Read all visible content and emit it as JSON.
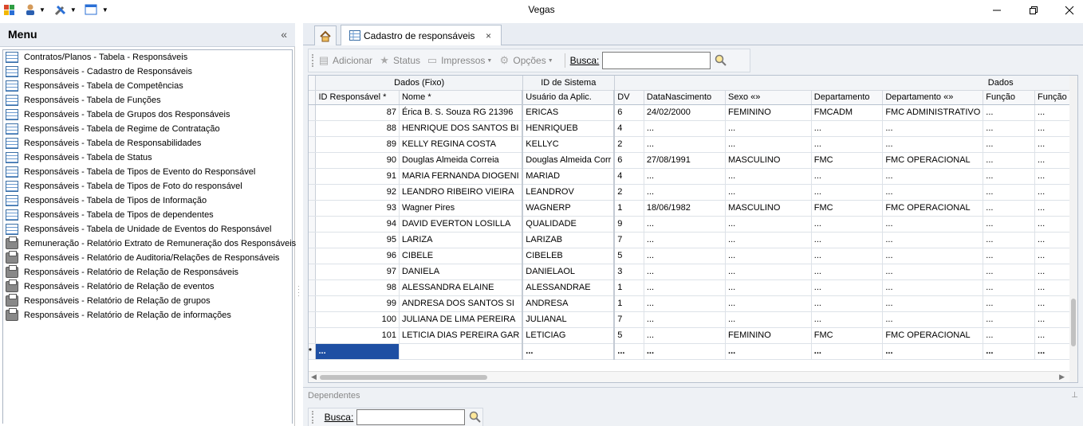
{
  "window": {
    "title": "Vegas",
    "controls": [
      "minimize",
      "restore",
      "close"
    ]
  },
  "menu": {
    "title": "Menu",
    "collapse_label": "«",
    "items": [
      {
        "label": "Contratos/Planos - Tabela - Responsáveis",
        "icon": "table-icon"
      },
      {
        "label": "Responsáveis - Cadastro de Responsáveis",
        "icon": "table-icon"
      },
      {
        "label": "Responsáveis - Tabela de Competências",
        "icon": "table-icon"
      },
      {
        "label": "Responsáveis - Tabela de Funções",
        "icon": "table-icon"
      },
      {
        "label": "Responsáveis - Tabela de Grupos dos Responsáveis",
        "icon": "table-icon"
      },
      {
        "label": "Responsáveis - Tabela de Regime de Contratação",
        "icon": "table-icon"
      },
      {
        "label": "Responsáveis - Tabela de Responsabilidades",
        "icon": "table-icon"
      },
      {
        "label": "Responsáveis - Tabela de Status",
        "icon": "table-icon"
      },
      {
        "label": "Responsáveis - Tabela de Tipos de Evento do Responsável",
        "icon": "table-icon"
      },
      {
        "label": "Responsáveis - Tabela de Tipos de Foto do responsável",
        "icon": "table-icon"
      },
      {
        "label": "Responsáveis - Tabela de Tipos de Informação",
        "icon": "table-icon"
      },
      {
        "label": "Responsáveis - Tabela de Tipos de dependentes",
        "icon": "table-icon"
      },
      {
        "label": "Responsáveis - Tabela de Unidade de Eventos do Responsável",
        "icon": "table-icon"
      },
      {
        "label": "Remuneração - Relatório Extrato de Remuneração dos Responsáveis",
        "icon": "printer-icon"
      },
      {
        "label": "Responsáveis - Relatório de Auditoria/Relações de Responsáveis",
        "icon": "printer-icon"
      },
      {
        "label": "Responsáveis - Relatório de Relação de Responsáveis",
        "icon": "printer-icon"
      },
      {
        "label": "Responsáveis - Relatório de Relação de eventos",
        "icon": "printer-icon"
      },
      {
        "label": "Responsáveis - Relatório de Relação de grupos",
        "icon": "printer-icon"
      },
      {
        "label": "Responsáveis - Relatório de Relação de informações",
        "icon": "printer-icon"
      }
    ]
  },
  "tabs": {
    "home_icon": "home-icon",
    "active_tab_label": "Cadastro de responsáveis",
    "close_glyph": "×"
  },
  "toolbar": {
    "add_label": "Adicionar",
    "status_label": "Status",
    "print_label": "Impressos",
    "options_label": "Opções",
    "search_label": "Busca:",
    "search_value": ""
  },
  "grid": {
    "bands": [
      "Dados (Fixo)",
      "ID de Sistema",
      "Dados"
    ],
    "columns": [
      "ID Responsável *",
      "Nome *",
      "Usuário da Aplic.",
      "DV",
      "DataNascimento",
      "Sexo «»",
      "Departamento",
      "Departamento «»",
      "Função",
      "Função «"
    ],
    "rows": [
      [
        "87",
        "Érica B. S. Souza RG 21396",
        "ERICAS",
        "6",
        "24/02/2000",
        "FEMININO",
        "FMCADM",
        "FMC ADMINISTRATIVO",
        "...",
        "..."
      ],
      [
        "88",
        "HENRIQUE DOS SANTOS BI",
        "HENRIQUEB",
        "4",
        "...",
        "...",
        "...",
        "...",
        "...",
        "..."
      ],
      [
        "89",
        "KELLY REGINA COSTA",
        "KELLYC",
        "2",
        "...",
        "...",
        "...",
        "...",
        "...",
        "..."
      ],
      [
        "90",
        "Douglas Almeida Correia",
        "Douglas Almeida Corr",
        "6",
        "27/08/1991",
        "MASCULINO",
        "FMC",
        "FMC OPERACIONAL",
        "...",
        "..."
      ],
      [
        "91",
        "MARIA FERNANDA DIOGENI",
        "MARIAD",
        "4",
        "...",
        "...",
        "...",
        "...",
        "...",
        "..."
      ],
      [
        "92",
        "LEANDRO RIBEIRO VIEIRA",
        "LEANDROV",
        "2",
        "...",
        "...",
        "...",
        "...",
        "...",
        "..."
      ],
      [
        "93",
        "Wagner Pires",
        "WAGNERP",
        "1",
        "18/06/1982",
        "MASCULINO",
        "FMC",
        "FMC OPERACIONAL",
        "...",
        "..."
      ],
      [
        "94",
        "DAVID EVERTON LOSILLA",
        "QUALIDADE",
        "9",
        "...",
        "...",
        "...",
        "...",
        "...",
        "..."
      ],
      [
        "95",
        "LARIZA",
        "LARIZAB",
        "7",
        "...",
        "...",
        "...",
        "...",
        "...",
        "..."
      ],
      [
        "96",
        "CIBELE",
        "CIBELEB",
        "5",
        "...",
        "...",
        "...",
        "...",
        "...",
        "..."
      ],
      [
        "97",
        "DANIELA",
        "DANIELAOL",
        "3",
        "...",
        "...",
        "...",
        "...",
        "...",
        "..."
      ],
      [
        "98",
        "ALESSANDRA ELAINE",
        "ALESSANDRAE",
        "1",
        "...",
        "...",
        "...",
        "...",
        "...",
        "..."
      ],
      [
        "99",
        "ANDRESA DOS SANTOS SI",
        "ANDRESA",
        "1",
        "...",
        "...",
        "...",
        "...",
        "...",
        "..."
      ],
      [
        "100",
        "JULIANA DE LIMA PEREIRA",
        "JULIANAL",
        "7",
        "...",
        "...",
        "...",
        "...",
        "...",
        "..."
      ],
      [
        "101",
        "LETICIA DIAS PEREIRA GAR",
        "LETICIAG",
        "5",
        "...",
        "FEMININO",
        "FMC",
        "FMC OPERACIONAL",
        "...",
        "..."
      ]
    ],
    "new_row_marker": "*",
    "new_row": [
      "...",
      "",
      "...",
      "...",
      "...",
      "...",
      "...",
      "...",
      "...",
      "..."
    ]
  },
  "dependents": {
    "title": "Dependentes",
    "search_label": "Busca:",
    "search_value": ""
  },
  "colors": {
    "selection": "#1e4fa3",
    "panel_bg": "#eef1f5"
  }
}
